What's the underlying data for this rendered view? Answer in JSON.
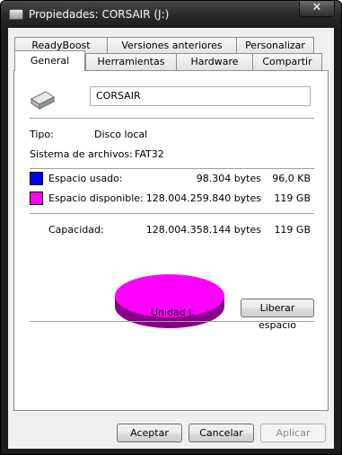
{
  "window": {
    "title": "Propiedades: CORSAIR (J:)",
    "close_symbol": "✕"
  },
  "tabs": {
    "row_top": [
      "ReadyBoost",
      "Versiones anteriores",
      "Personalizar"
    ],
    "row_bottom": [
      "General",
      "Herramientas",
      "Hardware",
      "Compartir"
    ],
    "active": "General"
  },
  "general": {
    "drive_icon": "usb-drive-icon",
    "volume_name": "CORSAIR",
    "type_label": "Tipo:",
    "type_value": "Disco local",
    "fs_label": "Sistema de archivos:",
    "fs_value": "FAT32",
    "used": {
      "label": "Espacio usado:",
      "bytes": "98.304 bytes",
      "size": "96,0 KB",
      "color": "#0000ff"
    },
    "free": {
      "label": "Espacio disponible:",
      "bytes": "128.004.259.840 bytes",
      "size": "119 GB",
      "color": "#ff00ff"
    },
    "capacity": {
      "label": "Capacidad:",
      "bytes": "128.004.358.144 bytes",
      "size": "119 GB"
    },
    "used_fraction": 8e-07,
    "drive_label": "Unidad J:",
    "cleanup_button": "Liberar espacio"
  },
  "buttons": {
    "ok": "Aceptar",
    "cancel": "Cancelar",
    "apply": "Aplicar"
  }
}
